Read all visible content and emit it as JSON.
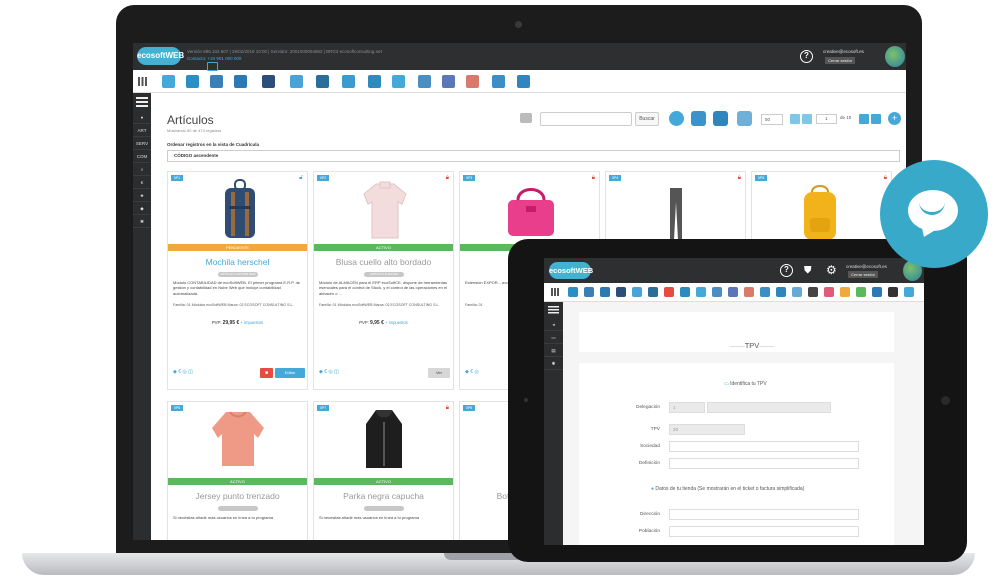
{
  "laptop": {
    "logo_text": "ecosoftWEB",
    "top_info": {
      "line1": "Versión 886.102.607 | 29/02/2018 10:00 | Servidor: 2001000004862 | BRG3 ecosoftconsulting.net",
      "contact": "Contacto: +34 901 000 000"
    },
    "help_label": "?",
    "user_email": "creative@ecosoft.es",
    "logout_label": "Cerrar sesión",
    "sidebar_items": [
      "ART",
      "SERV",
      "COM"
    ],
    "page_title": "Artículos",
    "page_subtitle": "Mostrando 50 de 474 registros",
    "search_button": "Buscar",
    "page_size": "50",
    "page_current": "1",
    "page_of": "de 10",
    "add_button": "+",
    "order_label": "Ordenar registros en la vista de Cuadrícula",
    "order_value": "CÓDIGO ascendente",
    "products": [
      {
        "ref": "0P1",
        "status": "PENDIENTE",
        "name": "Mochila herschel",
        "tag": "ARTÍCULO CONTABILIDAD",
        "desc_bold": "primer programa E.R.P. de gestión y contabilidad",
        "desc": "Módulo CONTABILIDAD de ecoSoftWEB. El primer programa E.R.P. de gestión y contabilidad en Nube Web que incluye contabilidad automatizada.",
        "meta": "Familia: 01 Módulos ecoSoftWEB Marca: 02 ECOSOFT CONSULTING S.L.",
        "price_label": "PVP:",
        "price": "29,95 €",
        "price_note": "+ impuestos",
        "edit_label": "Editar"
      },
      {
        "ref": "0P2",
        "status": "ACTIVO",
        "name": "Blusa cuello alto bordado",
        "tag": "ARTÍCULO ALMACÉN",
        "desc_bold": "Módulo de ALMACÉN para el ERP ecoSoftCE",
        "desc": "Módulo de ALMACÉN para el ERP ecoSoftCE, dispone de herramientas esenciales para el control de Stock, y el control de las operaciones en el almacén o ...",
        "meta": "Familia: 01 Módulos ecoSoftWEB Marca: 02 ECOSOFT CONSULTING S.L.",
        "price_label": "PVP:",
        "price": "9,95 €",
        "price_note": "+ impuestos",
        "view_label": "Ver"
      },
      {
        "ref": "0P3",
        "status": "ACTIVO",
        "name": "Bolso",
        "desc": "Extensión EXPOR... ecoSoftCE, Es necesario el...",
        "meta": "Familia: 01"
      },
      {
        "ref": "0P4"
      },
      {
        "ref": "0P5"
      },
      {
        "ref": "0P6",
        "status": "ACTIVO",
        "name": "Jersey punto trenzado",
        "desc": "Si necesitas añadir más usuarios en línea a tu programa"
      },
      {
        "ref": "0P7",
        "status": "ACTIVO",
        "name": "Parka negra capucha",
        "desc": "Si necesitas añadir más usuarios en línea a tu programa"
      },
      {
        "ref": "0P8",
        "name": "Botas"
      }
    ]
  },
  "tablet": {
    "logo_text": "ecosoftWEB",
    "help_label": "?",
    "user_email": "creative@ecosoft.es",
    "logout_label": "Cerrar sesión",
    "tpv_title": "TPV",
    "identify_label": "Identifica tu TPV",
    "fields": [
      {
        "label": "Delegación",
        "value": "1"
      },
      {
        "label": "TPV",
        "value": "20"
      },
      {
        "label": "Sociedad",
        "value": ""
      },
      {
        "label": "Definición",
        "value": ""
      }
    ],
    "store_section": "Datos de tu tienda (Se mostrarán en el ticket o factura simplificada)",
    "store_fields": [
      {
        "label": "Dirección",
        "value": ""
      },
      {
        "label": "Población",
        "value": ""
      }
    ]
  },
  "colors": {
    "accent": "#44a9d8",
    "active": "#5cb85c",
    "pending": "#f0a93b",
    "danger": "#e54d42",
    "chat": "#39a9c9"
  },
  "icons": [
    "grid-icon",
    "printer-icon",
    "lock-icon",
    "chat-icon",
    "gear-icon",
    "shield-icon",
    "help-icon",
    "monitor-icon"
  ]
}
